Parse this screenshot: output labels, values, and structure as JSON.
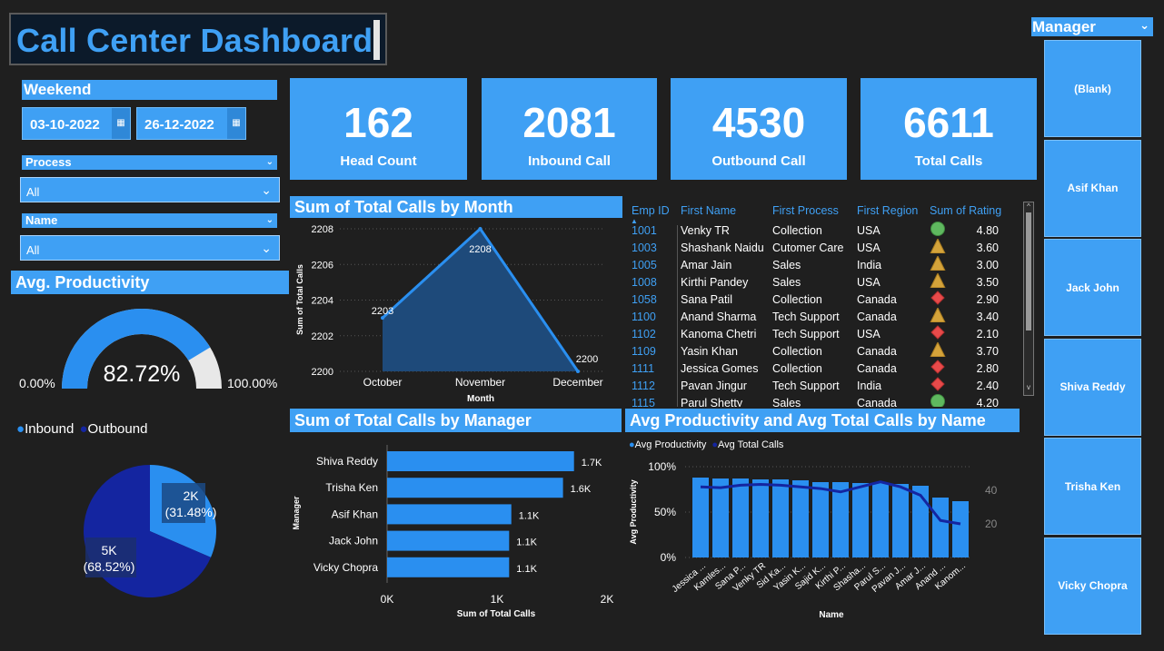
{
  "title": "Call Center Dashboard",
  "weekend": {
    "label": "Weekend",
    "start": "03-10-2022",
    "end": "26-12-2022"
  },
  "process": {
    "label": "Process",
    "value": "All"
  },
  "name": {
    "label": "Name",
    "value": "All"
  },
  "kpis": [
    {
      "value": "162",
      "label": "Head Count"
    },
    {
      "value": "2081",
      "label": "Inbound Call"
    },
    {
      "value": "4530",
      "label": "Outbound Call"
    },
    {
      "value": "6611",
      "label": "Total Calls"
    }
  ],
  "productivity": {
    "title": "Avg. Productivity",
    "value": "82.72%",
    "fraction": 0.8272,
    "min": "0.00%",
    "max": "100.00%"
  },
  "pie": {
    "legend": [
      "Inbound",
      "Outbound"
    ],
    "inbound": {
      "value": "2K",
      "pct": "(31.48%)",
      "fraction": 0.3148,
      "color": "#2a8ff0"
    },
    "outbound": {
      "value": "5K",
      "pct": "(68.52%)",
      "fraction": 0.6852,
      "color": "#1425a0"
    }
  },
  "month_chart": {
    "title": "Sum of Total Calls by Month",
    "ylabel": "Sum of Total Calls",
    "xlabel": "Month"
  },
  "manager_chart": {
    "title": "Sum of Total Calls by Manager",
    "ylabel": "Manager",
    "xlabel": "Sum of Total Calls"
  },
  "prod_chart": {
    "title": "Avg Productivity and Avg Total Calls by Name",
    "legend": [
      "Avg Productivity",
      "Avg Total Calls"
    ],
    "ylabel": "Avg Productivity",
    "xlabel": "Name"
  },
  "table": {
    "headers": [
      "Emp ID",
      "First Name",
      "First Process",
      "First Region",
      "Sum of Rating"
    ],
    "rows": [
      [
        "1001",
        "Venky TR",
        "Collection",
        "USA",
        "circle",
        "4.80"
      ],
      [
        "1003",
        "Shashank Naidu",
        "Cutomer Care",
        "USA",
        "triangle",
        "3.60"
      ],
      [
        "1005",
        "Amar Jain",
        "Sales",
        "India",
        "triangle",
        "3.00"
      ],
      [
        "1008",
        "Kirthi Pandey",
        "Sales",
        "USA",
        "triangle",
        "3.50"
      ],
      [
        "1058",
        "Sana Patil",
        "Collection",
        "Canada",
        "diamond",
        "2.90"
      ],
      [
        "1100",
        "Anand Sharma",
        "Tech Support",
        "Canada",
        "triangle",
        "3.40"
      ],
      [
        "1102",
        "Kanoma Chetri",
        "Tech Support",
        "USA",
        "diamond",
        "2.10"
      ],
      [
        "1109",
        "Yasin Khan",
        "Collection",
        "Canada",
        "triangle",
        "3.70"
      ],
      [
        "1111",
        "Jessica Gomes",
        "Collection",
        "Canada",
        "diamond",
        "2.80"
      ],
      [
        "1112",
        "Pavan Jingur",
        "Tech Support",
        "India",
        "diamond",
        "2.40"
      ],
      [
        "1115",
        "Parul Shetty",
        "Sales",
        "Canada",
        "circle",
        "4.20"
      ]
    ]
  },
  "manager_slicer": {
    "label": "Manager",
    "items": [
      "(Blank)",
      "Asif Khan",
      "Jack John",
      "Shiva Reddy",
      "Trisha Ken",
      "Vicky Chopra"
    ]
  },
  "chart_data": [
    {
      "type": "area",
      "title": "Sum of Total Calls by Month",
      "xlabel": "Month",
      "ylabel": "Sum of Total Calls",
      "categories": [
        "October",
        "November",
        "December"
      ],
      "values": [
        2203,
        2208,
        2200
      ],
      "data_labels": [
        "2203",
        "2208",
        "2200"
      ],
      "ylim": [
        2200,
        2208
      ],
      "yticks": [
        "2208",
        "2206",
        "2204",
        "2202",
        "2200"
      ],
      "grid": true
    },
    {
      "type": "bar",
      "title": "Sum of Total Calls by Manager",
      "xlabel": "Sum of Total Calls",
      "ylabel": "Manager",
      "categories": [
        "Shiva Reddy",
        "Trisha Ken",
        "Asif Khan",
        "Jack John",
        "Vicky Chopra"
      ],
      "values": [
        1700,
        1600,
        1130,
        1110,
        1110
      ],
      "data_labels": [
        "1.7K",
        "1.6K",
        "1.1K",
        "1.1K",
        "1.1K"
      ],
      "xlim": [
        0,
        2000
      ],
      "xticks": [
        "0K",
        "1K",
        "2K"
      ]
    },
    {
      "type": "bar",
      "title": "Avg Productivity and Avg Total Calls by Name",
      "xlabel": "Name",
      "ylabel": "Avg Productivity",
      "categories": [
        "Jessica ...",
        "Kamles...",
        "Sana P...",
        "Venky TR",
        "Sid Ka...",
        "Yasin K...",
        "Sajid K...",
        "Kirthi P...",
        "Shasha...",
        "Parul S...",
        "Pavan J...",
        "Amar J...",
        "Anand ...",
        "Kanom..."
      ],
      "series": [
        {
          "name": "Avg Productivity",
          "type": "bar",
          "values": [
            0.88,
            0.87,
            0.87,
            0.86,
            0.86,
            0.85,
            0.83,
            0.83,
            0.82,
            0.82,
            0.81,
            0.79,
            0.66,
            0.62
          ]
        },
        {
          "name": "Avg Total Calls",
          "type": "line",
          "values": [
            42,
            41.5,
            43,
            43.5,
            43,
            42,
            41,
            39,
            42,
            45,
            42,
            37,
            22,
            20
          ]
        }
      ],
      "ylim": [
        0,
        1
      ],
      "yticks": [
        "0%",
        "50%",
        "100%"
      ],
      "y2ticks": [
        "20",
        "40"
      ]
    }
  ]
}
